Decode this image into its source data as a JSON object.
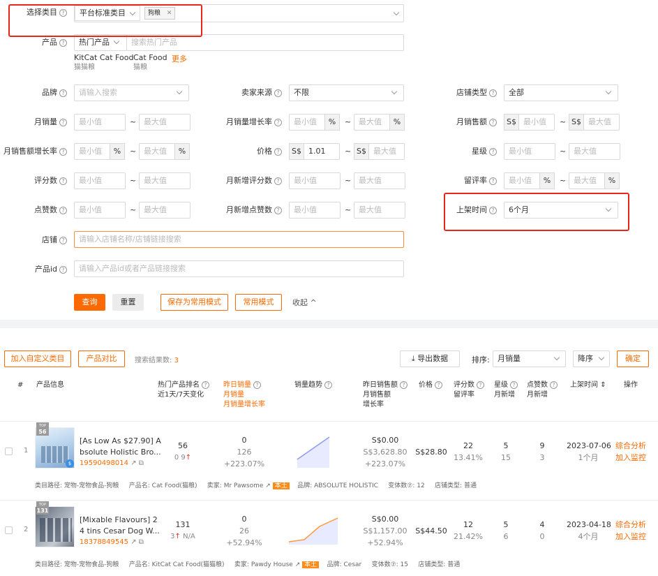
{
  "filters": {
    "category": {
      "label": "选择类目",
      "select": "平台标准类目",
      "tag": "狗粮"
    },
    "product": {
      "label": "产品",
      "select": "热门产品",
      "placeholder": "搜索热门产品",
      "suggest": [
        {
          "en": "KitCat Cat Food",
          "cn": "猫猫粮"
        },
        {
          "en": "Cat Food",
          "cn": "猫粮"
        }
      ],
      "more": "更多"
    },
    "brand": {
      "label": "品牌",
      "placeholder": "请输入搜索"
    },
    "seller_source": {
      "label": "卖家来源",
      "value": "不限"
    },
    "shop_type": {
      "label": "店铺类型",
      "value": "全部"
    },
    "monthly_sales": {
      "label": "月销量"
    },
    "monthly_sales_growth": {
      "label": "月销量增长率"
    },
    "monthly_revenue": {
      "label": "月销售额"
    },
    "monthly_revenue_growth": {
      "label": "月销售额增长率"
    },
    "price": {
      "label": "价格",
      "min": "1.01"
    },
    "rating": {
      "label": "星级"
    },
    "reviews": {
      "label": "评分数"
    },
    "new_reviews": {
      "label": "月新增评分数"
    },
    "retention": {
      "label": "留评率"
    },
    "likes": {
      "label": "点赞数"
    },
    "new_likes": {
      "label": "月新增点赞数"
    },
    "listing_time": {
      "label": "上架时间",
      "value": "6个月"
    },
    "shop": {
      "label": "店铺",
      "placeholder": "请输入店铺名称/店铺链接搜索"
    },
    "product_id": {
      "label": "产品id",
      "placeholder": "请输入产品id或者产品链接搜索"
    },
    "min": "最小值",
    "max": "最大值",
    "pct": "%",
    "cur": "S$",
    "tilde": "~"
  },
  "buttons": {
    "query": "查询",
    "reset": "重置",
    "save": "保存为常用模式",
    "common": "常用模式",
    "collapse": "收起"
  },
  "toolbar": {
    "add_category": "加入自定义类目",
    "compare": "产品对比",
    "result_label": "搜索结果数:",
    "result_count": "3",
    "export": "导出数据",
    "sort_label": "排序:",
    "sort_value": "月销量",
    "order": "降序",
    "confirm": "确定"
  },
  "table": {
    "headers": {
      "idx": "#",
      "info": "产品信息",
      "rank1": "热门产品排名",
      "rank2": "近1天/7天变化",
      "sales1": "昨日销量",
      "sales2": "月销量",
      "sales3": "月销量增长率",
      "trend": "销量趋势",
      "rev1": "昨日销售额",
      "rev2": "月销售额",
      "rev3": "增长率",
      "price": "价格",
      "rev_cnt1": "评分数",
      "rev_cnt2": "留评率",
      "star1": "星级",
      "star2": "月新增",
      "like1": "点赞数",
      "like2": "月新增",
      "time": "上架时间",
      "op": "操作"
    },
    "rows": [
      {
        "idx": "1",
        "badge": "TOP",
        "rank_badge": "56",
        "title1": "[As Low As $27.90] A",
        "title2": "bsolute Holistic Bro...",
        "id": "19590498014",
        "rank": "56",
        "rank_change": "0 9",
        "y_sales": "0",
        "m_sales": "126",
        "growth": "+223.07%",
        "y_rev": "S$0.00",
        "m_rev": "S$3,628.80",
        "rev_growth": "+223.07%",
        "price": "S$28.80",
        "reviews": "22",
        "retention": "13.41%",
        "stars": "5",
        "new_stars": "15",
        "likes": "9",
        "new_likes": "3",
        "date": "2023-07-06",
        "age": "1个月",
        "op1": "综合分析",
        "op2": "加入监控",
        "meta": {
          "path_label": "类目路径:",
          "path": "宠物-宠物食品-狗粮",
          "pname_label": "产品名:",
          "pname": "Cat Food(猫粮)",
          "seller_label": "卖家:",
          "seller": "Mr Pawsome",
          "local": "本土",
          "brand_label": "品牌:",
          "brand": "ABSOLUTE HOLISTIC",
          "var_label": "变体数⑦:",
          "var": "12",
          "shop_label": "店铺类型:",
          "shop": "普通"
        }
      },
      {
        "idx": "2",
        "badge": "TOP",
        "rank_badge": "131",
        "title1": "[Mixable Flavours] 2",
        "title2": "4 tins Cesar Dog W...",
        "id": "18378849545",
        "rank": "131",
        "rank_change": "3",
        "rank_change2": "N/A",
        "y_sales": "0",
        "m_sales": "26",
        "growth": "+52.94%",
        "y_rev": "S$0.00",
        "m_rev": "S$1,157.00",
        "rev_growth": "+52.94%",
        "price": "S$44.50",
        "reviews": "12",
        "retention": "21.42%",
        "stars": "5",
        "new_stars": "6",
        "likes": "4",
        "new_likes": "0",
        "date": "2023-04-18",
        "age": "4个月",
        "op1": "综合分析",
        "op2": "加入监控",
        "meta": {
          "path_label": "类目路径:",
          "path": "宠物-宠物食品-狗粮",
          "pname_label": "产品名:",
          "pname": "KitCat Cat Food(猫猫粮)",
          "seller_label": "卖家:",
          "seller": "Pawdy House",
          "local": "本土",
          "brand_label": "品牌:",
          "brand": "Cesar",
          "var_label": "变体数⑦:",
          "var": "15",
          "shop_label": "店铺类型:",
          "shop": "普通"
        }
      }
    ]
  }
}
